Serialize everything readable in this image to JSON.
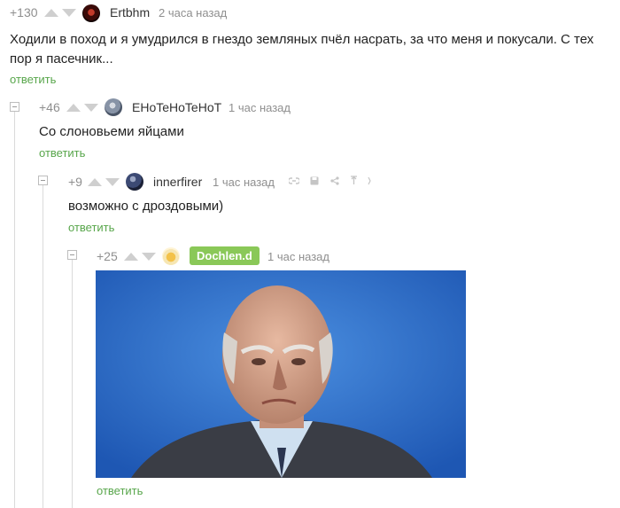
{
  "comments": [
    {
      "rating": "+130",
      "author": "Ertbhm",
      "time": "2 часа назад",
      "text": "Ходили в поход и я умудрился в гнездо земляных пчёл насрать, за что меня и покусали. С тех пор я пасечник...",
      "reply": "ответить"
    },
    {
      "rating": "+46",
      "author": "EHoTeHoTeHoT",
      "time": "1 час назад",
      "text": "Со слоновьеми яйцами",
      "reply": "ответить"
    },
    {
      "rating": "+9",
      "author": "innerfirer",
      "time": "1 час назад",
      "text": "возможно с дроздовыми)",
      "reply": "ответить",
      "tools": [
        "link-icon",
        "save-icon",
        "share-icon",
        "pin-icon",
        "more-icon"
      ]
    },
    {
      "rating": "+25",
      "author": "Dochlen.d",
      "time": "1 час назад",
      "reply": "ответить",
      "author_badge_color": "#8ac858"
    }
  ],
  "colors": {
    "reply_link": "#58a64b",
    "meta_gray": "#8f8f8f",
    "photo_background": "#2d6ec8"
  }
}
